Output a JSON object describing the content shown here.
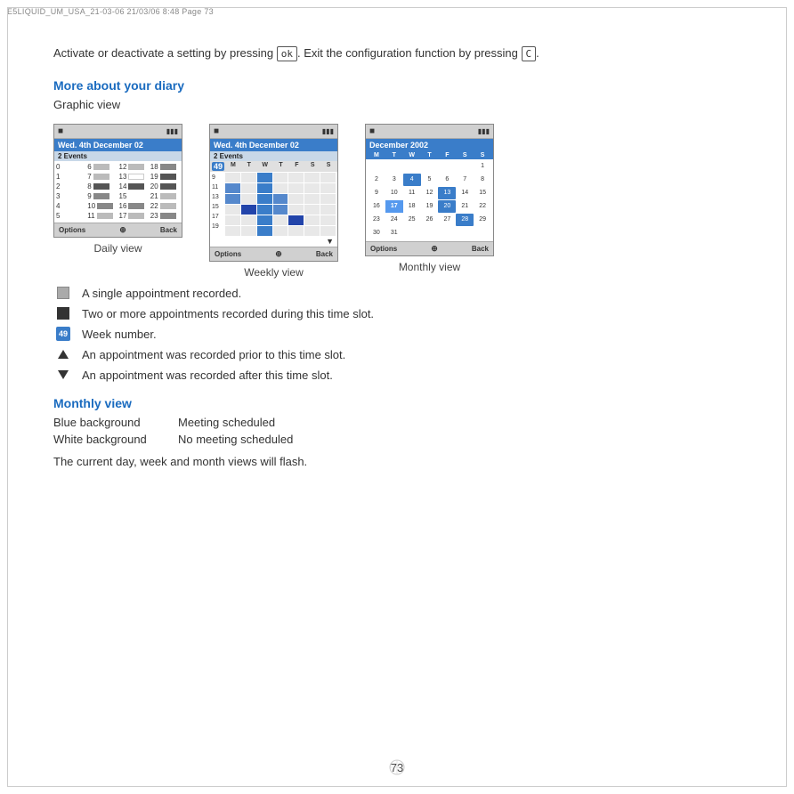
{
  "header": {
    "text": "E5LIQUID_UM_USA_21-03-06   21/03/06   8:48   Page 73"
  },
  "intro": {
    "text_before_ok": "Activate or deactivate a setting by pressing",
    "ok_key": "ok",
    "text_after_ok": ". Exit the configuration function by pressing",
    "c_key": "C",
    "text_end": "."
  },
  "section1": {
    "heading": "More about your diary",
    "subsection": "Graphic view"
  },
  "screens": {
    "daily": {
      "status_icon": "■",
      "signal": "▌▌▌",
      "date": "Wed. 4th December 02",
      "events": "2 Events",
      "caption": "Daily view",
      "bottom_left": "Options",
      "bottom_right": "Back"
    },
    "weekly": {
      "status_icon": "■",
      "signal": "▌▌▌",
      "date": "Wed. 4th December 02",
      "events": "2 Events",
      "week_number": "49",
      "days": [
        "M",
        "T",
        "W",
        "T",
        "F",
        "S",
        "S"
      ],
      "hours": [
        "9",
        "11",
        "13",
        "15",
        "17",
        "19"
      ],
      "caption": "Weekly view",
      "bottom_left": "Options",
      "bottom_right": "Back"
    },
    "monthly": {
      "status_icon": "■",
      "signal": "▌▌▌",
      "month_title": "December 2002",
      "days": [
        "M",
        "T",
        "W",
        "T",
        "F",
        "S",
        "S"
      ],
      "weeks": [
        [
          "",
          "",
          "",
          "",
          "",
          "",
          "1"
        ],
        [
          "2",
          "3",
          "4",
          "5",
          "6",
          "7",
          "8"
        ],
        [
          "9",
          "10",
          "11",
          "12",
          "13",
          "14",
          "15"
        ],
        [
          "16",
          "17",
          "18",
          "19",
          "20",
          "21",
          "22"
        ],
        [
          "23",
          "24",
          "25",
          "26",
          "27",
          "28",
          "29"
        ],
        [
          "30",
          "31",
          "",
          "",
          "",
          "",
          ""
        ]
      ],
      "meeting_days": [
        "4",
        "13",
        "20",
        "28"
      ],
      "caption": "Monthly view",
      "bottom_left": "Options",
      "bottom_right": "Back"
    }
  },
  "legend": {
    "items": [
      {
        "icon_type": "sq-light",
        "text": "A single appointment recorded."
      },
      {
        "icon_type": "sq-dark",
        "text": "Two or more appointments recorded during this time slot."
      },
      {
        "icon_type": "circle-49",
        "text": "Week number."
      },
      {
        "icon_type": "arrow-up",
        "text": "An appointment was recorded prior to this time slot."
      },
      {
        "icon_type": "arrow-down",
        "text": "An appointment was recorded after this time slot."
      }
    ]
  },
  "monthly_section": {
    "heading": "Monthly view",
    "rows": [
      {
        "label": "Blue background",
        "value": "Meeting scheduled"
      },
      {
        "label": "White background",
        "value": "No meeting scheduled"
      }
    ],
    "note": "The current day, week and month views will flash."
  },
  "page_number": "73"
}
